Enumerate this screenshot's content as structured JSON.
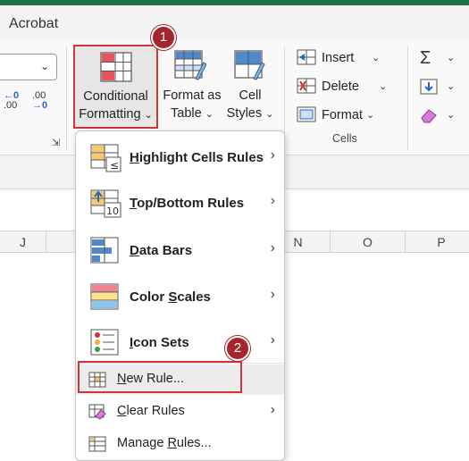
{
  "tab_bar": {
    "active_tab": "Acrobat"
  },
  "number_group": {
    "increase_decimal": {
      "top": "←0",
      "bottom": ".00"
    },
    "decrease_decimal": {
      "top": ".00",
      "bottom": "→0"
    }
  },
  "styles_group": {
    "conditional_formatting": {
      "line1": "Conditional",
      "line2": "Formatting"
    },
    "format_as_table": {
      "line1": "Format as",
      "line2": "Table"
    },
    "cell_styles": {
      "line1": "Cell",
      "line2": "Styles"
    }
  },
  "cells_group": {
    "label": "Cells",
    "insert": "Insert",
    "delete": "Delete",
    "format": "Format"
  },
  "columns": [
    "J",
    "N",
    "O",
    "P"
  ],
  "steps": {
    "step1": "1",
    "step2": "2"
  },
  "menu": {
    "items": [
      {
        "label_first": "H",
        "label_rest": "ighlight Cells Rules",
        "icon": "highlight-cells-rules-icon",
        "submenu": true
      },
      {
        "label_first": "T",
        "label_rest": "op/Bottom Rules",
        "icon": "top-bottom-rules-icon",
        "submenu": true
      },
      {
        "label_first": "D",
        "label_rest": "ata Bars",
        "icon": "data-bars-icon",
        "submenu": true
      },
      {
        "label_pre": "Color ",
        "label_first": "S",
        "label_rest": "cales",
        "icon": "color-scales-icon",
        "submenu": true
      },
      {
        "label_first": "I",
        "label_rest": "con Sets",
        "icon": "icon-sets-icon",
        "submenu": true
      }
    ],
    "new_rule": {
      "label_first": "N",
      "label_rest": "ew Rule..."
    },
    "clear_rules": {
      "label_first": "C",
      "label_rest": "lear Rules"
    },
    "manage_rules": {
      "label_pre": "Manage ",
      "label_first": "R",
      "label_rest": "ules..."
    }
  },
  "colors": {
    "excel_green": "#1e7145",
    "highlight_red": "#d13438",
    "badge_red": "#a4262c"
  }
}
